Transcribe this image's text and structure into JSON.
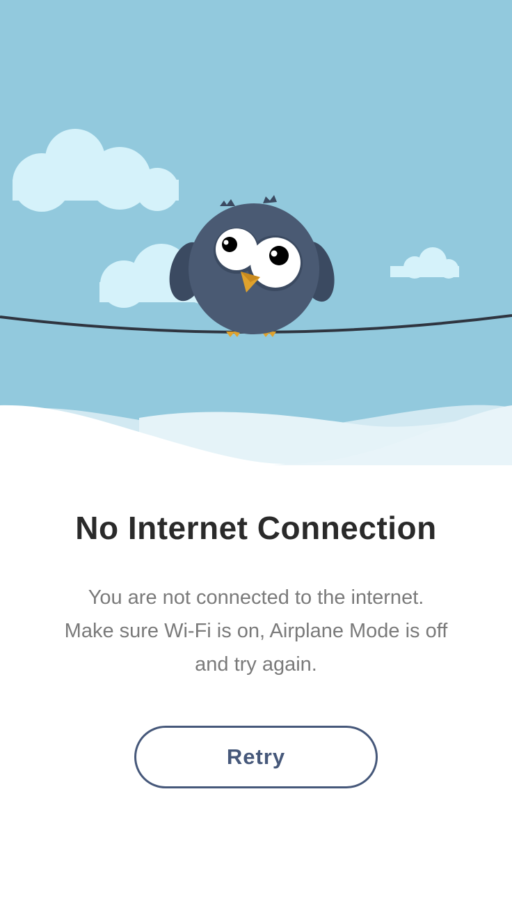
{
  "screen": {
    "title": "No Internet Connection",
    "message_lines": [
      "You are not connected to the internet.",
      "Make sure Wi-Fi is on, Airplane Mode is off",
      "and try again."
    ],
    "retry_label": "Retry"
  },
  "illustration": {
    "sky_color": "#92c9dd",
    "cloud_color": "#d5f2fa",
    "bird_color": "#4a5a73",
    "beak_color": "#e0a22c",
    "icon": "owl-on-wire-illustration"
  },
  "colors": {
    "accent": "#46587a",
    "title": "#2a2a2a",
    "message": "#7a7a7a"
  }
}
